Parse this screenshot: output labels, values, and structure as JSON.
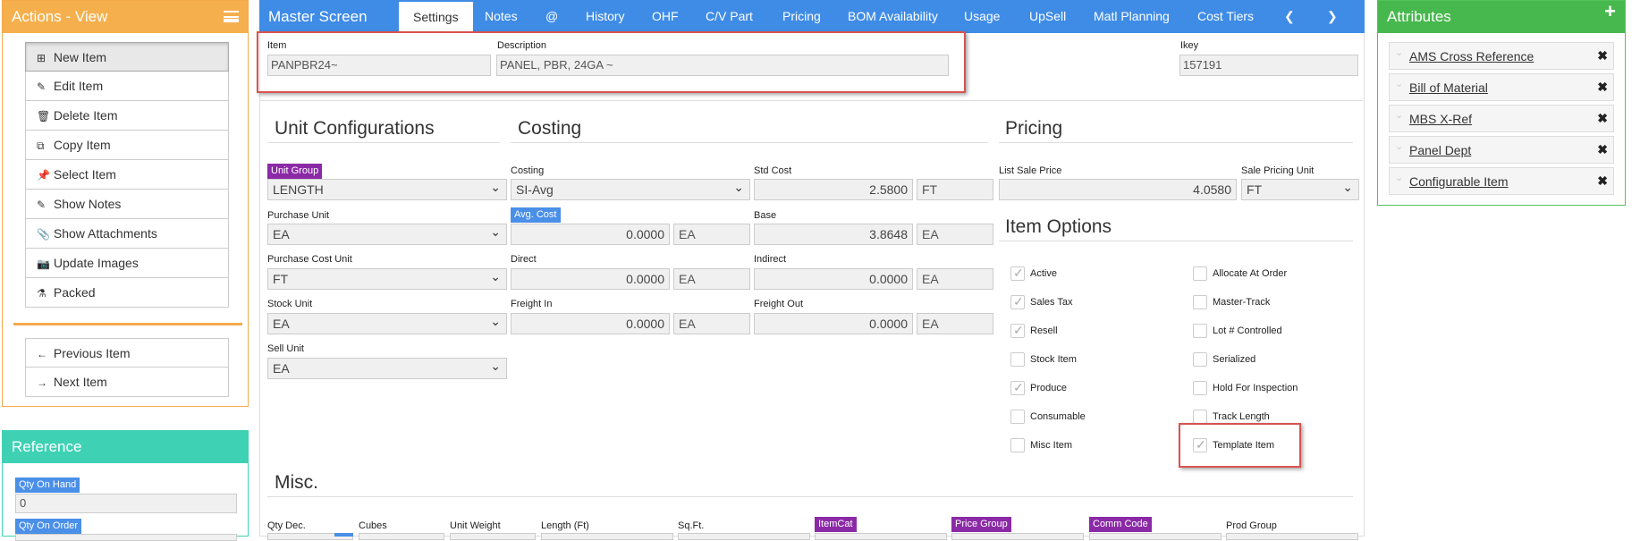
{
  "actions": {
    "title": "Actions - View",
    "items": [
      {
        "icon": "⊞",
        "label": "New Item"
      },
      {
        "icon": "✎",
        "label": "Edit Item"
      },
      {
        "icon": "🗑",
        "label": "Delete Item"
      },
      {
        "icon": "⧉",
        "label": "Copy Item"
      },
      {
        "icon": "📌",
        "label": "Select Item"
      },
      {
        "icon": "✎",
        "label": "Show Notes"
      },
      {
        "icon": "📎",
        "label": "Show Attachments"
      },
      {
        "icon": "📷",
        "label": "Update Images"
      },
      {
        "icon": "⚗",
        "label": "Packed"
      }
    ],
    "nav": [
      {
        "icon": "←",
        "label": "Previous Item"
      },
      {
        "icon": "→",
        "label": "Next Item"
      }
    ]
  },
  "reference": {
    "title": "Reference",
    "qty_on_hand_label": "Qty On Hand",
    "qty_on_hand_value": "0",
    "qty_on_order_label": "Qty On Order"
  },
  "tabs": {
    "title": "Master Screen",
    "items": [
      "Settings",
      "Notes",
      "@",
      "History",
      "OHF",
      "C/V Part",
      "Pricing",
      "BOM Availability",
      "Usage",
      "UpSell",
      "Matl Planning",
      "Cost Tiers"
    ],
    "prev": "❮",
    "next": "❯"
  },
  "header": {
    "item_label": "Item",
    "item_value": "PANPBR24~",
    "desc_label": "Description",
    "desc_value": "PANEL, PBR, 24GA ~",
    "ikey_label": "Ikey",
    "ikey_value": "157191"
  },
  "unit_config": {
    "title": "Unit Configurations",
    "unit_group_label": "Unit Group",
    "unit_group_value": "LENGTH",
    "purchase_unit_label": "Purchase Unit",
    "purchase_unit_value": "EA",
    "purchase_cost_unit_label": "Purchase Cost Unit",
    "purchase_cost_unit_value": "FT",
    "stock_unit_label": "Stock Unit",
    "stock_unit_value": "EA",
    "sell_unit_label": "Sell Unit",
    "sell_unit_value": "EA"
  },
  "costing": {
    "title": "Costing",
    "costing_label": "Costing",
    "costing_value": "SI-Avg",
    "avg_cost_label": "Avg. Cost",
    "avg_cost_value": "0.0000",
    "avg_cost_unit": "EA",
    "direct_label": "Direct",
    "direct_value": "0.0000",
    "direct_unit": "EA",
    "freight_in_label": "Freight In",
    "freight_in_value": "0.0000",
    "freight_in_unit": "EA",
    "std_cost_label": "Std Cost",
    "std_cost_value": "2.5800",
    "std_cost_unit": "FT",
    "base_label": "Base",
    "base_value": "3.8648",
    "base_unit": "EA",
    "indirect_label": "Indirect",
    "indirect_value": "0.0000",
    "indirect_unit": "EA",
    "freight_out_label": "Freight Out",
    "freight_out_value": "0.0000",
    "freight_out_unit": "EA"
  },
  "pricing": {
    "title": "Pricing",
    "list_sale_price_label": "List Sale Price",
    "list_sale_price_value": "4.0580",
    "sale_pricing_unit_label": "Sale Pricing Unit",
    "sale_pricing_unit_value": "FT"
  },
  "item_options": {
    "title": "Item Options",
    "left": [
      {
        "label": "Active",
        "checked": true
      },
      {
        "label": "Sales Tax",
        "checked": true
      },
      {
        "label": "Resell",
        "checked": true
      },
      {
        "label": "Stock Item",
        "checked": false
      },
      {
        "label": "Produce",
        "checked": true
      },
      {
        "label": "Consumable",
        "checked": false
      },
      {
        "label": "Misc Item",
        "checked": false
      }
    ],
    "right": [
      {
        "label": "Allocate At Order",
        "checked": false
      },
      {
        "label": "Master-Track",
        "checked": false
      },
      {
        "label": "Lot # Controlled",
        "checked": false
      },
      {
        "label": "Serialized",
        "checked": false
      },
      {
        "label": "Hold For Inspection",
        "checked": false
      },
      {
        "label": "Track Length",
        "checked": false
      },
      {
        "label": "Template Item",
        "checked": true
      }
    ]
  },
  "misc": {
    "title": "Misc.",
    "labels": [
      "Qty Dec.",
      "Cubes",
      "Unit Weight",
      "Length (Ft)",
      "Sq.Ft."
    ],
    "badges": [
      "ItemCat",
      "Price Group",
      "Comm Code"
    ],
    "prod_group_label": "Prod Group"
  },
  "attributes": {
    "title": "Attributes",
    "add": "+",
    "items": [
      "AMS Cross Reference",
      "Bill of Material",
      "MBS X-Ref",
      "Panel Dept",
      "Configurable Item"
    ]
  },
  "colors": {
    "actions": "#f5b04d",
    "reference": "#3ed1b4",
    "tabbar": "#3f8ce6",
    "attributes": "#47b84d",
    "badge_purple": "#8b2aa6",
    "badge_blue": "#4a8fe8",
    "highlight": "#d9534f"
  }
}
